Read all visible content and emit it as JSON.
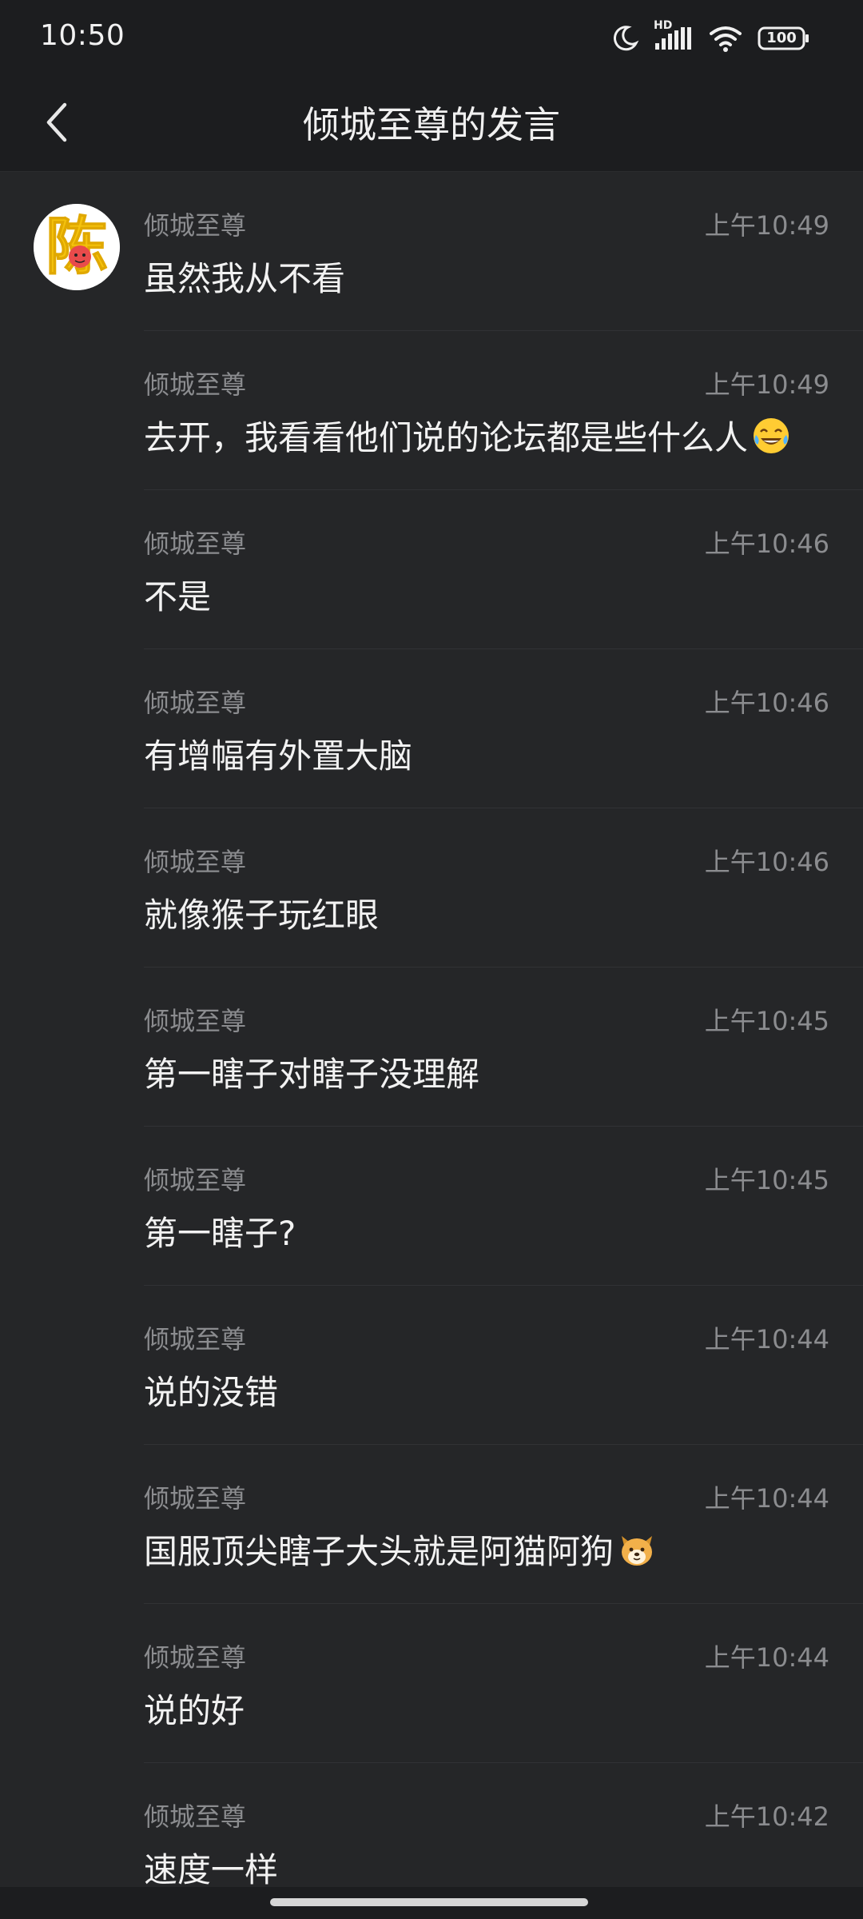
{
  "status_bar": {
    "time": "10:50",
    "network_label": "HD",
    "battery": "100",
    "icons": [
      "moon-icon",
      "signal-icon",
      "wifi-icon",
      "battery-icon"
    ]
  },
  "header": {
    "title": "倾城至尊的发言",
    "back_icon": "chevron-left-icon"
  },
  "avatar": {
    "character": "陈",
    "colors": {
      "glyph": "#f4c20d",
      "ring": "#ffffff"
    }
  },
  "messages": [
    {
      "author": "倾城至尊",
      "time": "上午10:49",
      "text": "虽然我从不看",
      "emoji": ""
    },
    {
      "author": "倾城至尊",
      "time": "上午10:49",
      "text": "去开，我看看他们说的论坛都是些什么人",
      "emoji": "tears-of-joy"
    },
    {
      "author": "倾城至尊",
      "time": "上午10:46",
      "text": "不是",
      "emoji": ""
    },
    {
      "author": "倾城至尊",
      "time": "上午10:46",
      "text": "有增幅有外置大脑",
      "emoji": ""
    },
    {
      "author": "倾城至尊",
      "time": "上午10:46",
      "text": "就像猴子玩红眼",
      "emoji": ""
    },
    {
      "author": "倾城至尊",
      "time": "上午10:45",
      "text": "第一瞎子对瞎子没理解",
      "emoji": ""
    },
    {
      "author": "倾城至尊",
      "time": "上午10:45",
      "text": "第一瞎子?",
      "emoji": ""
    },
    {
      "author": "倾城至尊",
      "time": "上午10:44",
      "text": "说的没错",
      "emoji": ""
    },
    {
      "author": "倾城至尊",
      "time": "上午10:44",
      "text": "国服顶尖瞎子大头就是阿猫阿狗",
      "emoji": "dog-face"
    },
    {
      "author": "倾城至尊",
      "time": "上午10:44",
      "text": "说的好",
      "emoji": ""
    },
    {
      "author": "倾城至尊",
      "time": "上午10:42",
      "text": "速度一样",
      "emoji": ""
    }
  ],
  "colors": {
    "background": "#252628",
    "header_background": "#1c1d1f",
    "meta_text": "#8b8c8f",
    "message_text": "#f2f2f2"
  }
}
